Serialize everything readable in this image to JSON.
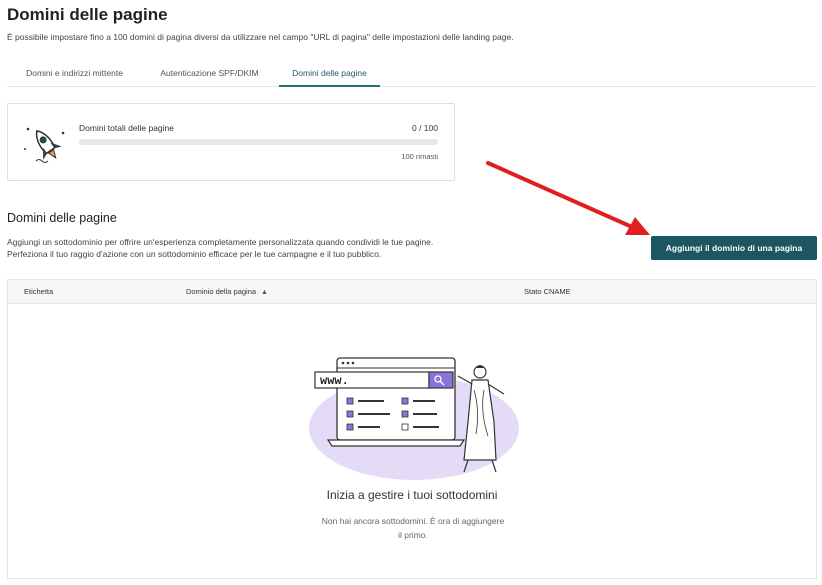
{
  "header": {
    "title": "Domini delle pagine",
    "subtitle": "È possibile impostare fino a 100 domini di pagina diversi da utilizzare nel campo \"URL di pagina\" delle impostazioni delle landing page."
  },
  "tabs": [
    {
      "label": "Domini e indirizzi mittente",
      "active": false
    },
    {
      "label": "Autenticazione SPF/DKIM",
      "active": false
    },
    {
      "label": "Domini delle pagine",
      "active": true
    }
  ],
  "stats": {
    "label": "Domini totali delle pagine",
    "count": "0 / 100",
    "progress_fraction": 0,
    "remaining": "100 rimasti"
  },
  "section": {
    "title": "Domini delle pagine",
    "desc_line1": "Aggiungi un sottodominio per offrire un'esperienza completamente personalizzata quando condividi le tue pagine.",
    "desc_line2": "Perfeziona il tuo raggio d'azione con un sottodominio efficace per le tue campagne e il tuo pubblico.",
    "add_button": "Aggiungi il dominio di una pagina"
  },
  "table": {
    "columns": [
      "Etichetta",
      "Dominio della pagina",
      "Stato CNAME"
    ],
    "sort_icon": "sort-icon"
  },
  "empty_state": {
    "illustration_text": "www.",
    "title": "Inizia a gestire i tuoi sottodomini",
    "desc_line1": "Non hai ancora sottodomini. È ora di aggiungere",
    "desc_line2": "il primo."
  },
  "colors": {
    "accent": "#1d5660",
    "arrow": "#e02020",
    "illustration_bg": "#e4dcf7",
    "illustration_purple": "#8b74d8"
  }
}
